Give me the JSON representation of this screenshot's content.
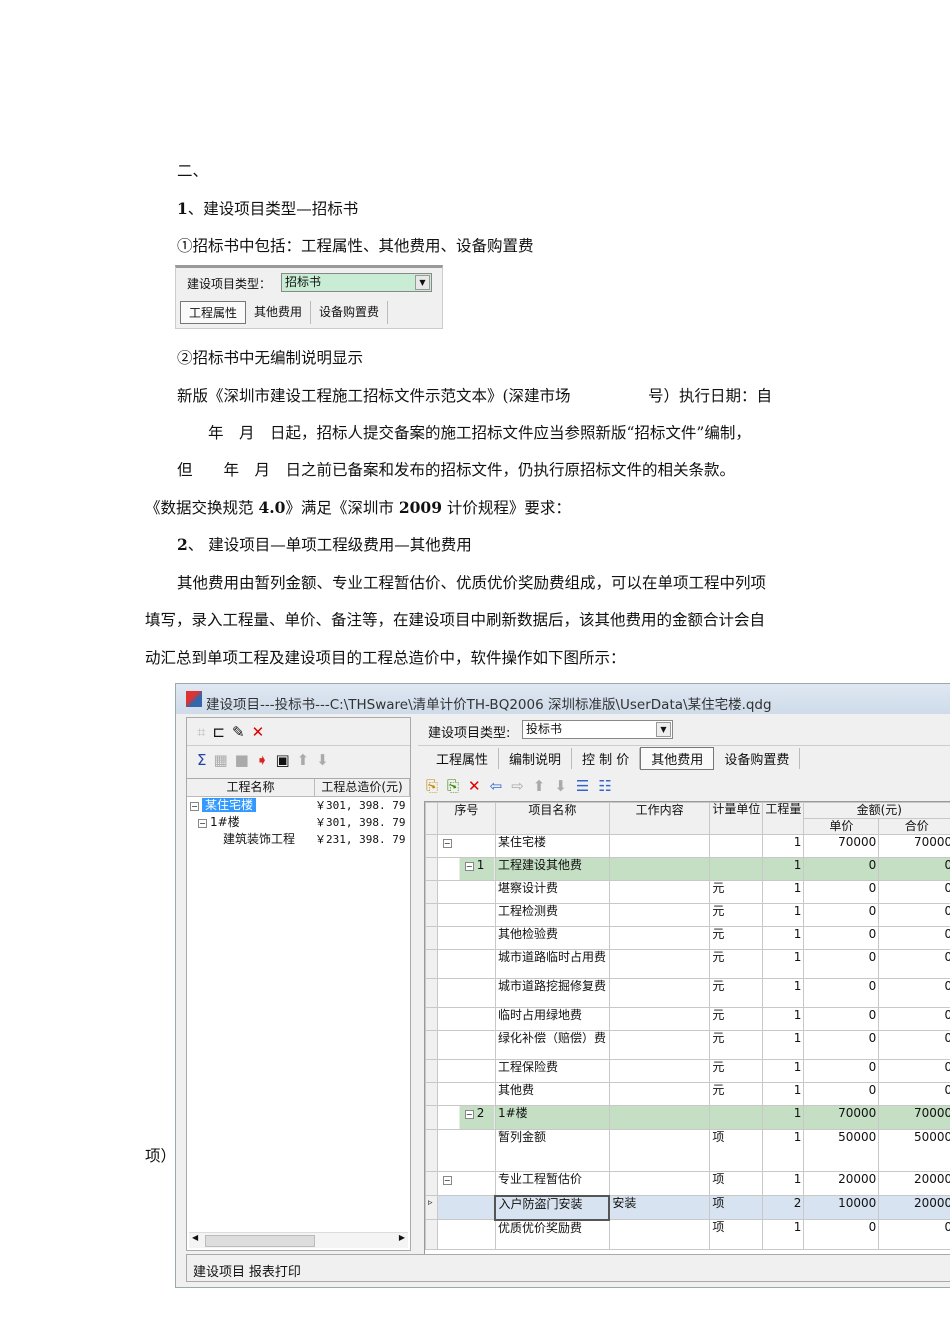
{
  "doc": {
    "l1": "二、",
    "l2_num": "1",
    "l2": "、建设项目类型—招标书",
    "l3": "①招标书中包括：工程属性、其他费用、设备购置费",
    "l4": "②招标书中无编制说明显示",
    "l5": "新版《深圳市建设工程施工招标文件示范文本》(深建市场　　　　　号）执行日期：自",
    "l6": "　　年　月　日起，招标人提交备案的施工招标文件应当参照新版“招标文件”编制，",
    "l7": "但　　年　月　日之前已备案和发布的招标文件，仍执行原招标文件的相关条款。",
    "l8a": "《数据交换规范 ",
    "l8b": "4.0",
    "l8c": "》满足《深圳市 ",
    "l8d": "2009",
    "l8e": " 计价规程》要求：",
    "l9_num": "2",
    "l9": "、 建设项目—单项工程级费用—其他费用",
    "l10": "其他费用由暂列金额、专业工程暂估价、优质优价奖励费组成，可以在单项工程中列项",
    "l11": "填写，录入工程量、单价、备注等，在建设项目中刷新数据后，该其他费用的金额合计会自",
    "l12": "动汇总到单项工程及建设项目的工程总造价中，软件操作如下图所示：",
    "l13": "项）"
  },
  "mini": {
    "label": "建设项目类型：",
    "value": "招标书",
    "tabs": [
      "工程属性",
      "其他费用",
      "设备购置费"
    ]
  },
  "win": {
    "title": "建设项目---投标书---C:\\THSware\\清单计价TH-BQ2006 深圳标准版\\UserData\\某住宅楼.qdg",
    "tree_headers": [
      "工程名称",
      "工程总造价(元)"
    ],
    "tree": [
      {
        "name": "某住宅楼",
        "value": "￥301, 398. 79"
      },
      {
        "name": "1#楼",
        "value": "￥301, 398. 79"
      },
      {
        "name": "建筑装饰工程",
        "value": "￥231, 398. 79"
      }
    ],
    "type_label": "建设项目类型:",
    "type_value": "投标书",
    "tabs": [
      "工程属性",
      "编制说明",
      "控 制 价",
      "其他费用",
      "设备购置费"
    ],
    "active_tab": 3,
    "headers": {
      "seq": "序号",
      "name": "项目名称",
      "content": "工作内容",
      "unit": "计量单位",
      "qty": "工程量",
      "amount": "金额(元)",
      "price": "单价",
      "total": "合价"
    },
    "rows": [
      {
        "seq": "",
        "name": "某住宅楼",
        "content": "",
        "unit": "",
        "qty": "1",
        "price": "70000",
        "total": "70000"
      },
      {
        "seq": "1",
        "name": "工程建设其他费",
        "content": "",
        "unit": "",
        "qty": "1",
        "price": "0",
        "total": "0"
      },
      {
        "seq": "",
        "name": "堪察设计费",
        "content": "",
        "unit": "元",
        "qty": "1",
        "price": "0",
        "total": "0"
      },
      {
        "seq": "",
        "name": "工程检测费",
        "content": "",
        "unit": "元",
        "qty": "1",
        "price": "0",
        "total": "0"
      },
      {
        "seq": "",
        "name": "其他检验费",
        "content": "",
        "unit": "元",
        "qty": "1",
        "price": "0",
        "total": "0"
      },
      {
        "seq": "",
        "name": "城市道路临时占用费",
        "content": "",
        "unit": "元",
        "qty": "1",
        "price": "0",
        "total": "0"
      },
      {
        "seq": "",
        "name": "城市道路挖掘修复费",
        "content": "",
        "unit": "元",
        "qty": "1",
        "price": "0",
        "total": "0"
      },
      {
        "seq": "",
        "name": "临时占用绿地费",
        "content": "",
        "unit": "元",
        "qty": "1",
        "price": "0",
        "total": "0"
      },
      {
        "seq": "",
        "name": "绿化补偿（赔偿）费",
        "content": "",
        "unit": "元",
        "qty": "1",
        "price": "0",
        "total": "0"
      },
      {
        "seq": "",
        "name": "工程保险费",
        "content": "",
        "unit": "元",
        "qty": "1",
        "price": "0",
        "total": "0"
      },
      {
        "seq": "",
        "name": "其他费",
        "content": "",
        "unit": "元",
        "qty": "1",
        "price": "0",
        "total": "0"
      },
      {
        "seq": "2",
        "name": "1#楼",
        "content": "",
        "unit": "",
        "qty": "1",
        "price": "70000",
        "total": "70000"
      },
      {
        "seq": "",
        "name": "暂列金额",
        "content": "",
        "unit": "项",
        "qty": "1",
        "price": "50000",
        "total": "50000"
      },
      {
        "seq": "",
        "name": "专业工程暂估价",
        "content": "",
        "unit": "项",
        "qty": "1",
        "price": "20000",
        "total": "20000"
      },
      {
        "seq": "",
        "name": "入户防盗门安装",
        "content": "安装",
        "unit": "项",
        "qty": "2",
        "price": "10000",
        "total": "20000"
      },
      {
        "seq": "",
        "name": "优质优价奖励费",
        "content": "",
        "unit": "项",
        "qty": "1",
        "price": "0",
        "total": "0"
      }
    ],
    "status_tabs": [
      "建设项目",
      "报表打印"
    ]
  }
}
